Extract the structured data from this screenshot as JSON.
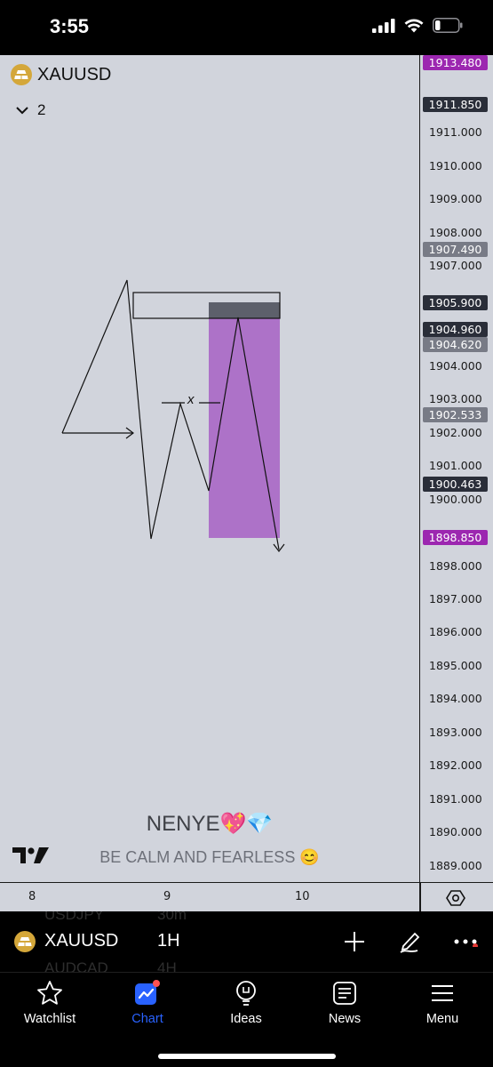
{
  "status_bar": {
    "time": "3:55"
  },
  "chart": {
    "symbol": "XAUUSD",
    "collapse_count": "2",
    "price_ticks": [
      "1911.000",
      "1910.000",
      "1909.000",
      "1908.000",
      "1907.000",
      "1904.000",
      "1903.000",
      "1902.000",
      "1901.000",
      "1900.000",
      "1898.000",
      "1897.000",
      "1896.000",
      "1895.000",
      "1894.000",
      "1893.000",
      "1892.000",
      "1891.000",
      "1890.000",
      "1889.000"
    ],
    "price_badges": [
      {
        "label": "1913.480",
        "color": "#9c27b0"
      },
      {
        "label": "1911.850",
        "color": "#2a2e39"
      },
      {
        "label": "1907.490",
        "color": "#787b86"
      },
      {
        "label": "1905.900",
        "color": "#2a2e39"
      },
      {
        "label": "1904.960",
        "color": "#2a2e39"
      },
      {
        "label": "1904.620",
        "color": "#787b86"
      },
      {
        "label": "1902.533",
        "color": "#787b86"
      },
      {
        "label": "1900.463",
        "color": "#2a2e39"
      },
      {
        "label": "1898.850",
        "color": "#9c27b0"
      }
    ],
    "drawing_marker": "x",
    "watermark_title": "NENYE💖💎",
    "watermark_subtitle": "BE CALM AND FEARLESS 😊"
  },
  "time_axis": {
    "labels": [
      "8",
      "9",
      "10"
    ]
  },
  "symbol_toolbar": {
    "symbol": "XAUUSD",
    "interval": "1H",
    "ghost_rows": [
      {
        "symbol": "USDJPY",
        "interval": "30m"
      },
      {
        "symbol": "AUDCAD",
        "interval": "4H"
      }
    ]
  },
  "tabs": [
    {
      "label": "Watchlist",
      "icon": "star-icon",
      "active": false
    },
    {
      "label": "Chart",
      "icon": "chart-icon",
      "active": true
    },
    {
      "label": "Ideas",
      "icon": "lightbulb-icon",
      "active": false
    },
    {
      "label": "News",
      "icon": "news-icon",
      "active": false
    },
    {
      "label": "Menu",
      "icon": "hamburger-icon",
      "active": false
    }
  ],
  "colors": {
    "chart_bg": "#d1d4dc",
    "accent": "#2962ff",
    "zone_dark": "#5d606b",
    "zone_purple": "#ad72c8",
    "gold": "#d4a73a"
  }
}
